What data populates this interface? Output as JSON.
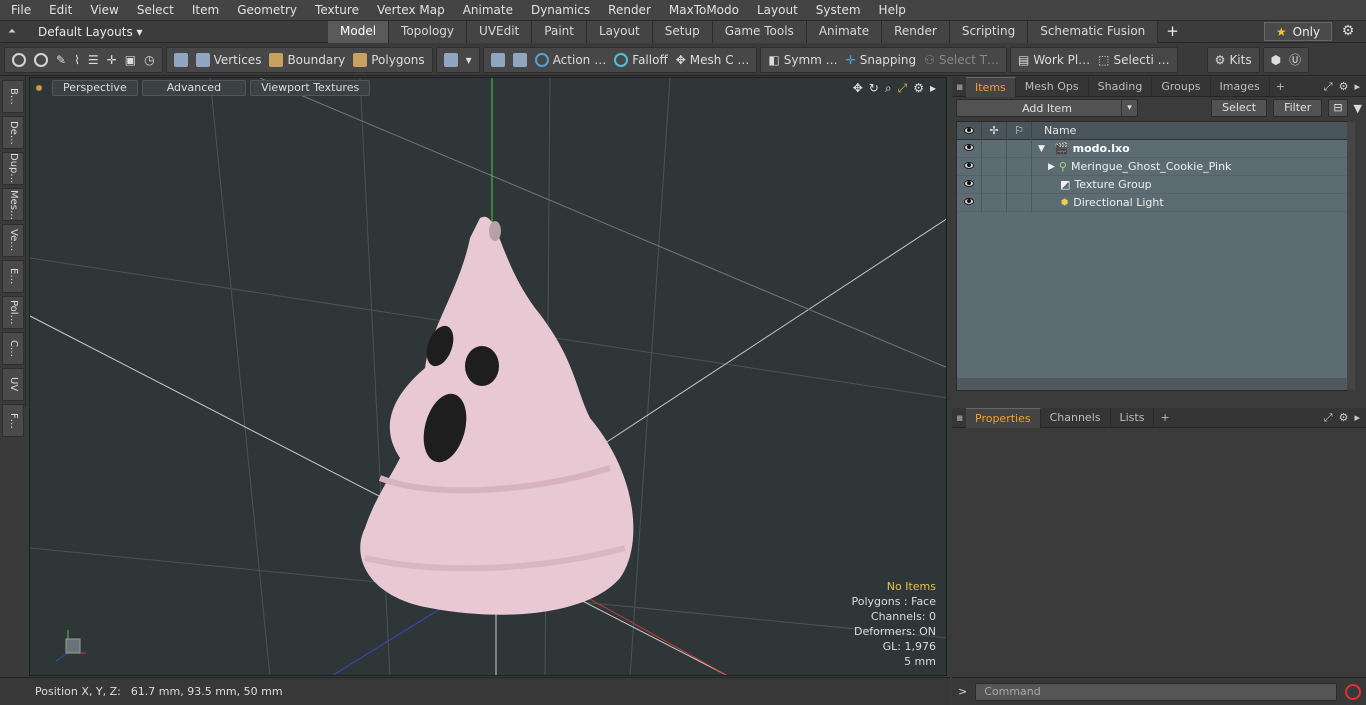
{
  "menu": [
    "File",
    "Edit",
    "View",
    "Select",
    "Item",
    "Geometry",
    "Texture",
    "Vertex Map",
    "Animate",
    "Dynamics",
    "Render",
    "MaxToModo",
    "Layout",
    "System",
    "Help"
  ],
  "layout": {
    "default_layouts": "Default Layouts ▾",
    "tabs": [
      "Model",
      "Topology",
      "UVEdit",
      "Paint",
      "Layout",
      "Setup",
      "Game Tools",
      "Animate",
      "Render",
      "Scripting",
      "Schematic Fusion"
    ],
    "active_tab": "Model",
    "only_label": "Only"
  },
  "toolbar": {
    "vertices": "Vertices",
    "boundary": "Boundary",
    "polygons": "Polygons",
    "action": "Action",
    "falloff": "Falloff",
    "mesh": "Mesh C …",
    "symm": "Symm …",
    "snapping": "Snapping",
    "select_t": "Select T…",
    "work_pl": "Work Pl…",
    "selecti": "Selecti …",
    "kits": "Kits"
  },
  "sidetabs": [
    "B…",
    "De…",
    "Dup…",
    "Mes…",
    "Ve…",
    "E…",
    "Pol…",
    "C…",
    "UV",
    "F…"
  ],
  "viewport": {
    "perspective": "Perspective",
    "advanced": "Advanced",
    "viewport_textures": "Viewport Textures",
    "stats": {
      "no_items": "No Items",
      "polygons": "Polygons : Face",
      "channels": "Channels: 0",
      "deformers": "Deformers: ON",
      "gl": "GL: 1,976",
      "scale": "5 mm"
    }
  },
  "status": {
    "label": "Position X, Y, Z:",
    "value": "61.7 mm, 93.5 mm, 50 mm"
  },
  "items_panel": {
    "tabs": [
      "Items",
      "Mesh Ops",
      "Shading",
      "Groups",
      "Images"
    ],
    "active_tab": "Items",
    "add_item": "Add Item",
    "select": "Select",
    "filter": "Filter",
    "column_name": "Name",
    "rows": [
      {
        "name": "modo.lxo",
        "indent": 0
      },
      {
        "name": "Meringue_Ghost_Cookie_Pink",
        "indent": 1
      },
      {
        "name": "Texture Group",
        "indent": 1
      },
      {
        "name": "Directional Light",
        "indent": 1
      }
    ]
  },
  "properties_panel": {
    "tabs": [
      "Properties",
      "Channels",
      "Lists"
    ],
    "active_tab": "Properties"
  },
  "command": {
    "placeholder": "Command",
    "prompt": ">"
  }
}
